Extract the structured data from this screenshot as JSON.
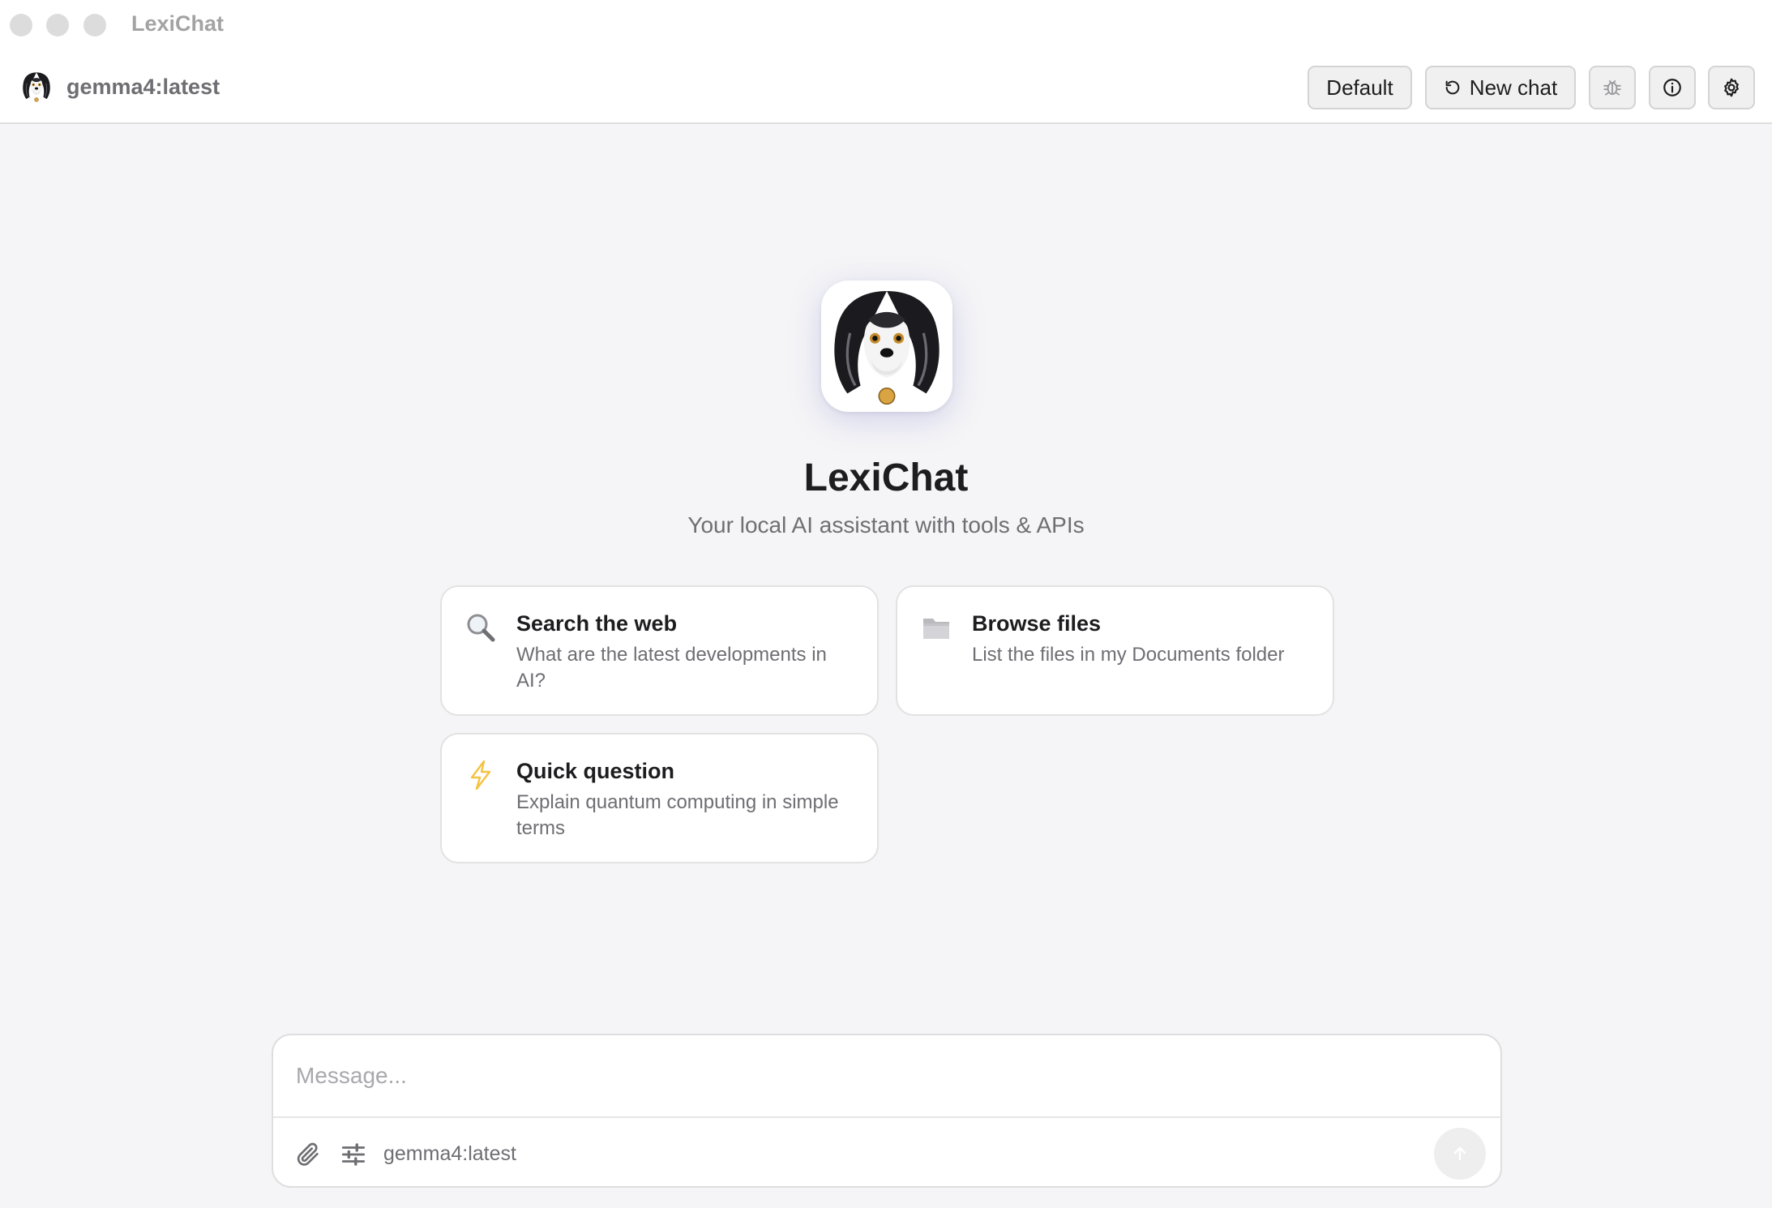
{
  "window": {
    "title": "LexiChat"
  },
  "toolbar": {
    "model_name": "gemma4:latest",
    "profile_label": "Default",
    "new_chat_label": "New chat",
    "icons": [
      "refresh-icon",
      "bug-icon",
      "info-icon",
      "gear-icon"
    ]
  },
  "hero": {
    "title": "LexiChat",
    "subtitle": "Your local AI assistant with tools & APIs"
  },
  "suggestions": [
    {
      "icon": "magnifier-icon",
      "title": "Search the web",
      "description": "What are the latest developments in AI?"
    },
    {
      "icon": "folder-icon",
      "title": "Browse files",
      "description": "List the files in my Documents folder"
    },
    {
      "icon": "lightning-icon",
      "title": "Quick question",
      "description": "Explain quantum computing in simple terms"
    }
  ],
  "composer": {
    "placeholder": "Message...",
    "value": "",
    "model_name": "gemma4:latest",
    "icons": [
      "paperclip-icon",
      "sliders-icon",
      "send-arrow-icon"
    ]
  },
  "colors": {
    "background": "#f5f5f7",
    "card_border": "#e2e2e2",
    "text_primary": "#1d1d1f",
    "text_secondary": "#6e6e73",
    "lightning": "#f5c242"
  }
}
